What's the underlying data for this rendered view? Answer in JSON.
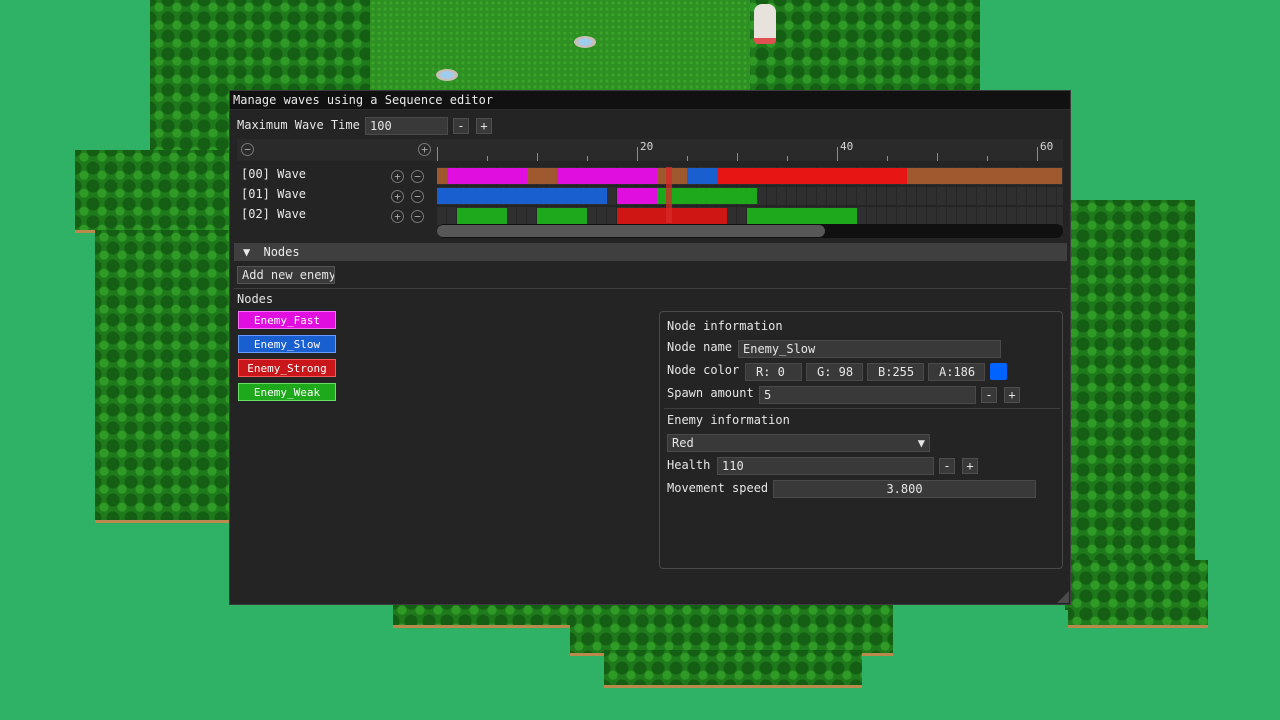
{
  "window": {
    "title": "Manage waves using a Sequence editor"
  },
  "max_wave": {
    "label": "Maximum Wave Time",
    "value": "100",
    "minus": "-",
    "plus": "+"
  },
  "timeline": {
    "ticks": [
      "20",
      "40",
      "60"
    ],
    "collapse_icon": "minus-circle-icon",
    "add_icon": "plus-circle-icon"
  },
  "waves": [
    {
      "label": "[00] Wave",
      "bars": [
        {
          "color": "#a0592e",
          "start": 0.0,
          "end": 62.5
        },
        {
          "color": "#e10ee0",
          "start": 1.0,
          "end": 9.0
        },
        {
          "color": "#e10ee0",
          "start": 12.0,
          "end": 22.0
        },
        {
          "color": "#1a5fd0",
          "start": 25.0,
          "end": 28.0
        },
        {
          "color": "#e81515",
          "start": 28.0,
          "end": 47.0
        }
      ]
    },
    {
      "label": "[01] Wave",
      "bars": [
        {
          "color": "#1a5fd0",
          "start": 0.0,
          "end": 17.0
        },
        {
          "color": "#e10ee0",
          "start": 18.0,
          "end": 22.0
        },
        {
          "color": "#1ea81b",
          "start": 22.0,
          "end": 32.0
        }
      ]
    },
    {
      "label": "[02] Wave",
      "bars": [
        {
          "color": "#1ea81b",
          "start": 2.0,
          "end": 7.0
        },
        {
          "color": "#1ea81b",
          "start": 10.0,
          "end": 15.0
        },
        {
          "color": "#d01515",
          "start": 18.0,
          "end": 29.0
        },
        {
          "color": "#1ea81b",
          "start": 31.0,
          "end": 42.0
        }
      ]
    }
  ],
  "nodes_section": {
    "title": "Nodes",
    "add_button": "Add new enemy",
    "list_label": "Nodes",
    "items": [
      {
        "label": "Enemy_Fast",
        "color": "#e10ee0"
      },
      {
        "label": "Enemy_Slow",
        "color": "#1a5fd0"
      },
      {
        "label": "Enemy_Strong",
        "color": "#c8161b"
      },
      {
        "label": "Enemy_Weak",
        "color": "#1ea81b"
      }
    ]
  },
  "node_info": {
    "header": "Node information",
    "name_label": "Node name",
    "name_value": "Enemy_Slow",
    "color_label": "Node color",
    "color_r": "R:  0",
    "color_g": "G: 98",
    "color_b": "B:255",
    "color_a": "A:186",
    "swatch_color": "#0062ff",
    "spawn_label": "Spawn amount",
    "spawn_value": "5",
    "minus": "-",
    "plus": "+"
  },
  "enemy_info": {
    "header": "Enemy information",
    "type_value": "Red",
    "health_label": "Health",
    "health_value": "110",
    "speed_label": "Movement speed",
    "speed_value": "3.800"
  }
}
